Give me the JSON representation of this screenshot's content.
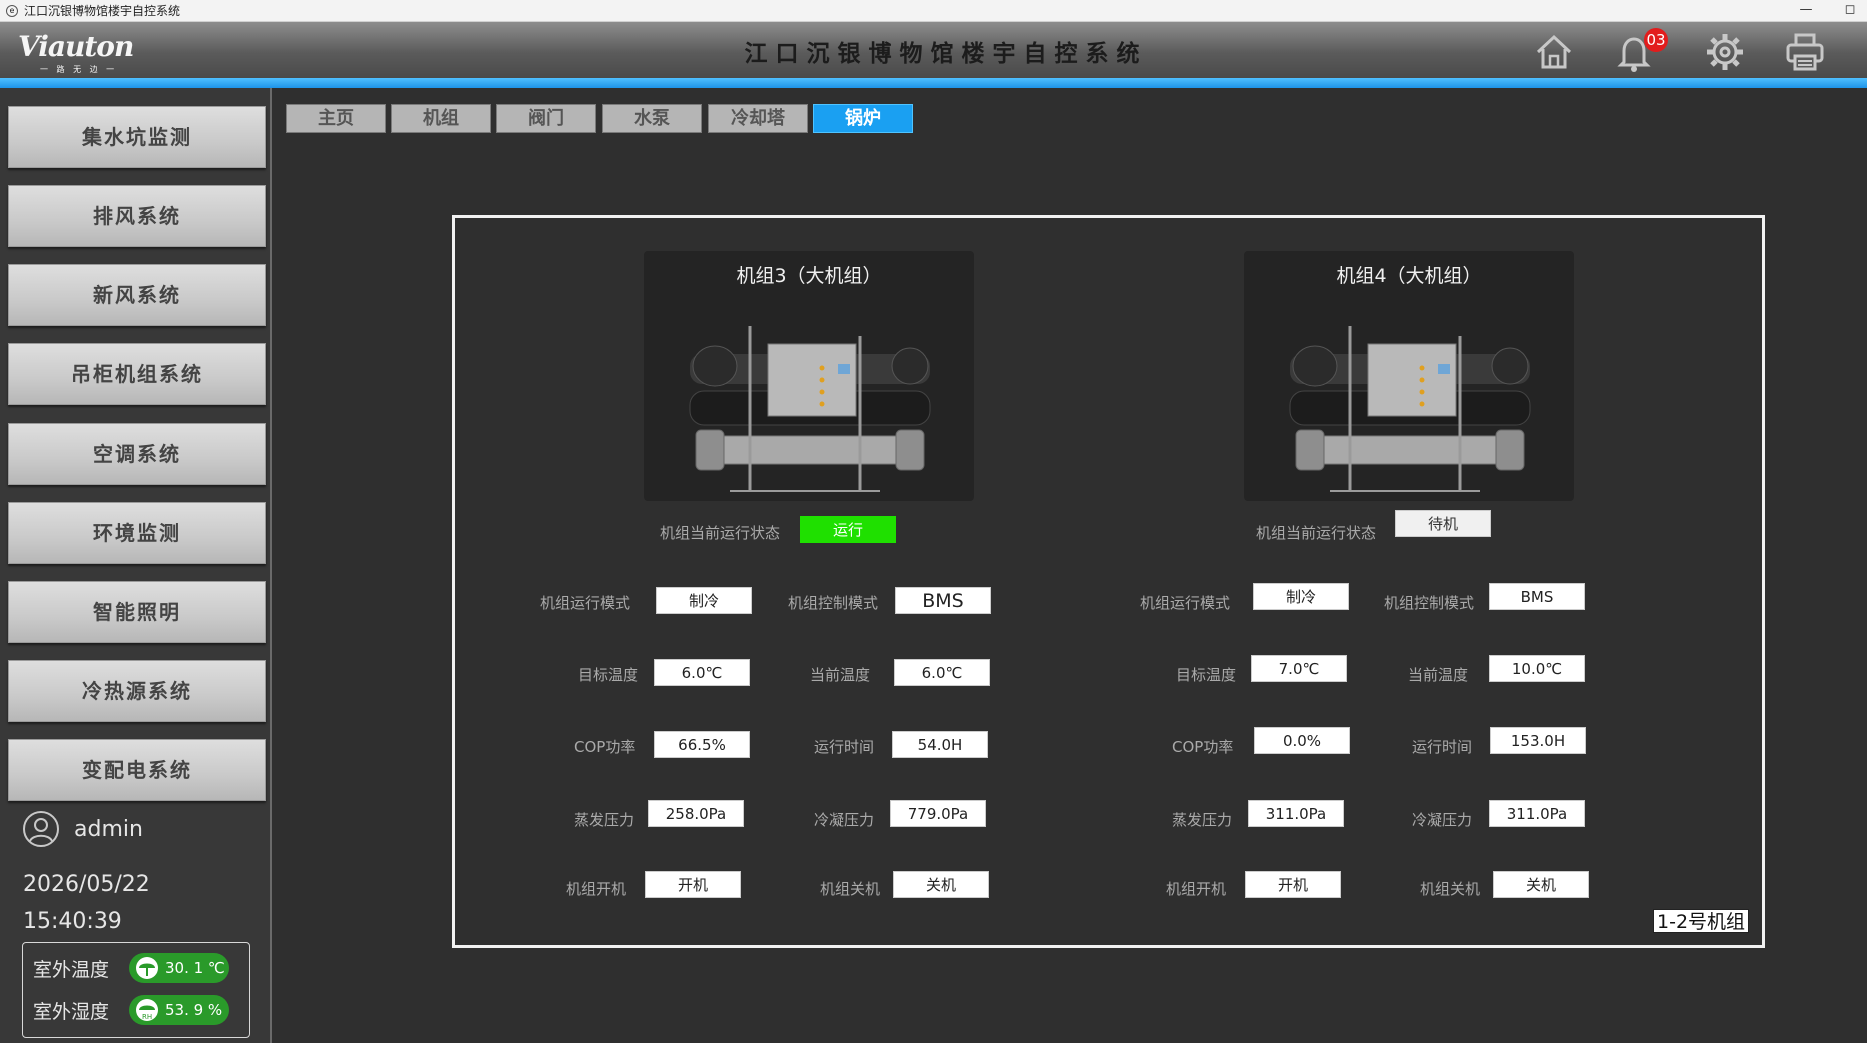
{
  "window": {
    "title": "江口沉银博物馆楼宇自控系统",
    "minimize_icon": "—",
    "maximize_icon": "◻"
  },
  "header": {
    "logo_text": "Viauton",
    "logo_sub": "一 路 无 边 一",
    "title": "江口沉银博物馆楼宇自控系统",
    "alarm_count": "03",
    "icons": [
      "home-icon",
      "bell-icon",
      "gear-icon",
      "printer-icon"
    ]
  },
  "sidebar": {
    "items": [
      {
        "label": "集水坑监测"
      },
      {
        "label": "排风系统"
      },
      {
        "label": "新风系统"
      },
      {
        "label": "吊柜机组系统"
      },
      {
        "label": "空调系统"
      },
      {
        "label": "环境监测"
      },
      {
        "label": "智能照明"
      },
      {
        "label": "冷热源系统"
      },
      {
        "label": "变配电系统"
      }
    ],
    "user": "admin",
    "date": "2026/05/22",
    "time": "15:40:39",
    "weather": {
      "temp_label": "室外温度",
      "temp_value": "30. 1 ℃",
      "humidity_label": "室外湿度",
      "humidity_value": "53. 9 %"
    }
  },
  "tabs": [
    {
      "label": "主页",
      "active": false
    },
    {
      "label": "机组",
      "active": false
    },
    {
      "label": "阀门",
      "active": false
    },
    {
      "label": "水泵",
      "active": false
    },
    {
      "label": "冷却塔",
      "active": false
    },
    {
      "label": "锅炉",
      "active": true
    }
  ],
  "labels": {
    "status": "机组当前运行状态",
    "run_mode": "机组运行模式",
    "control_mode": "机组控制模式",
    "target_temp": "目标温度",
    "current_temp": "当前温度",
    "cop": "COP功率",
    "run_time": "运行时间",
    "evap_pressure": "蒸发压力",
    "cond_pressure": "冷凝压力",
    "power_on": "机组开机",
    "power_off": "机组关机"
  },
  "units": [
    {
      "name": "机组3（大机组）",
      "status": "运行",
      "run_mode": "制冷",
      "control_mode": "BMS",
      "target_temp": "6.0℃",
      "current_temp": "6.0℃",
      "cop": "66.5%",
      "run_time": "54.0H",
      "evap_pressure": "258.0Pa",
      "cond_pressure": "779.0Pa",
      "power_on": "开机",
      "power_off": "关机"
    },
    {
      "name": "机组4（大机组）",
      "status": "待机",
      "run_mode": "制冷",
      "control_mode": "BMS",
      "target_temp": "7.0℃",
      "current_temp": "10.0℃",
      "cop": "0.0%",
      "run_time": "153.0H",
      "evap_pressure": "311.0Pa",
      "cond_pressure": "311.0Pa",
      "power_on": "开机",
      "power_off": "关机"
    }
  ],
  "unit_group_tag": "1-2号机组",
  "colors": {
    "accent": "#1aa0f2",
    "status_running": "#1fe000",
    "weather_pill": "#2a9a2a",
    "alarm_badge": "#e21c1c"
  }
}
